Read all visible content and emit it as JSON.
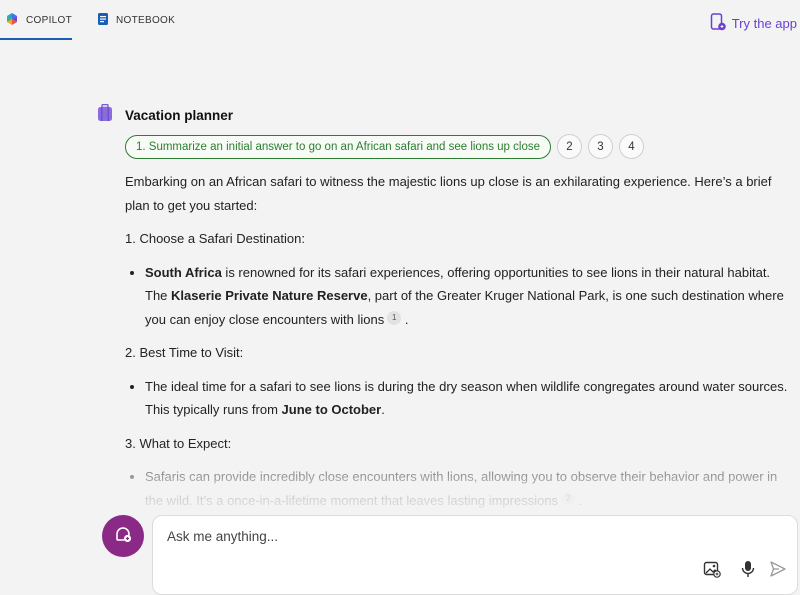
{
  "tabs": [
    {
      "label": "COPILOT",
      "icon": "copilot-logo-icon",
      "active": true
    },
    {
      "label": "NOTEBOOK",
      "icon": "notebook-icon",
      "active": false
    }
  ],
  "try_app": {
    "label": "Try the app",
    "icon": "phone-app-icon"
  },
  "conversation": {
    "title": "Vacation planner",
    "title_icon": "suitcase-icon",
    "steps": {
      "active_label": "1. Summarize an initial answer to go on an African safari and see lions up close",
      "numbers": [
        "2",
        "3",
        "4"
      ]
    },
    "intro": "Embarking on an African safari to witness the majestic lions up close is an exhilarating experience. Here’s a brief plan to get you started:",
    "sections": {
      "s1": {
        "heading": "1. Choose a Safari Destination:",
        "b1": "South Africa",
        "t1": " is renowned for its safari experiences, offering opportunities to see lions in their natural habitat. The ",
        "b2": "Klaserie Private Nature Reserve",
        "t2": ", part of the Greater Kruger National Park, is one such destination where you can enjoy close encounters with lions",
        "cite": "1",
        "end": "."
      },
      "s2": {
        "heading": "2. Best Time to Visit:",
        "t1": "The ideal time for a safari to see lions is during the dry season when wildlife congregates around water sources. This typically runs from ",
        "b1": "June to October",
        "end": "."
      },
      "s3": {
        "heading": "3. What to Expect:",
        "t1": "Safaris can provide incredibly close encounters with lions, allowing you to observe their behavior and power in the wild. It’s a once-in-a-lifetime moment that leaves lasting impressions",
        "cite": "2",
        "end": "."
      }
    }
  },
  "input": {
    "placeholder": "Ask me anything...",
    "new_topic_icon": "new-topic-icon",
    "image_icon": "image-add-icon",
    "mic_icon": "microphone-icon",
    "send_icon": "send-icon"
  },
  "colors": {
    "background": "#f3f3f3",
    "accent_blue": "#1b5fb4",
    "step_green": "#2e7d32",
    "purple": "#6b3fd4",
    "new_topic": "#8b2a86"
  }
}
